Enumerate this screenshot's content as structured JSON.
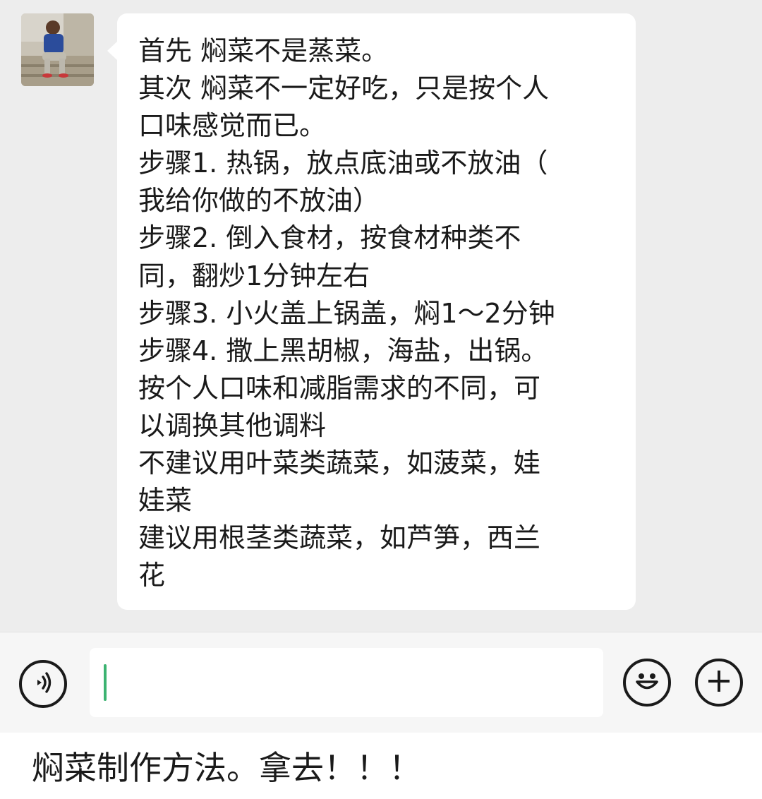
{
  "chat": {
    "message_lines": [
      "首先 焖菜不是蒸菜。",
      "其次 焖菜不一定好吃，只是按个人",
      "口味感觉而已。",
      "步骤1. 热锅，放点底油或不放油（",
      "我给你做的不放油）",
      "步骤2. 倒入食材，按食材种类不",
      "同，翻炒1分钟左右",
      "步骤3. 小火盖上锅盖，焖1～2分钟",
      "步骤4. 撒上黑胡椒，海盐，出锅。",
      "按个人口味和减脂需求的不同，可",
      "以调换其他调料",
      "不建议用叶菜类蔬菜，如菠菜，娃",
      "娃菜",
      "建议用根茎类蔬菜，如芦笋，西兰",
      "花"
    ]
  },
  "input_bar": {
    "voice_icon": "voice-icon",
    "emoji_icon": "smiley-icon",
    "plus_icon": "plus-icon",
    "cursor_color": "#3cb371"
  },
  "caption": "焖菜制作方法。拿去！！！"
}
